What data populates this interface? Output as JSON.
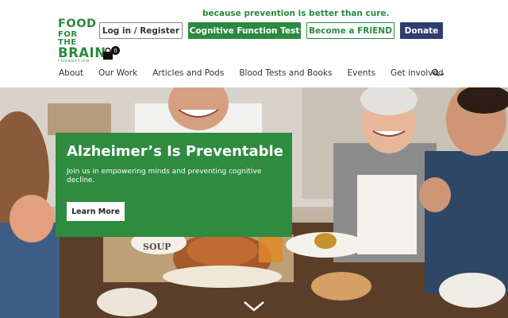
{
  "header": {
    "logo": {
      "line1": "FOOD",
      "line2": "FOR THE",
      "line3": "BRAIN",
      "line4": "FOUNDATION"
    },
    "tagline": "because prevention is better than cure.",
    "buttons": {
      "login": "Log in / Register",
      "cognitive_test": "Cognitive Function Test",
      "friend": "Become a FRIEND",
      "donate": "Donate"
    },
    "cart": {
      "icon": "shopping-bag-icon",
      "count": "0"
    },
    "search_icon": "search-icon"
  },
  "nav": {
    "items": [
      "About",
      "Our Work",
      "Articles and Pods",
      "Blood Tests and Books",
      "Events",
      "Get involved"
    ]
  },
  "hero": {
    "title": "Alzheimer’s Is Preventable",
    "subtitle": "Join us in empowering minds and preventing cognitive decline.",
    "cta": "Learn More",
    "photo_sign": "SOUP"
  },
  "colors": {
    "brand_green": "#2b8a3e",
    "card_green": "#2e8b3f",
    "donate_navy": "#2f3d6e"
  }
}
